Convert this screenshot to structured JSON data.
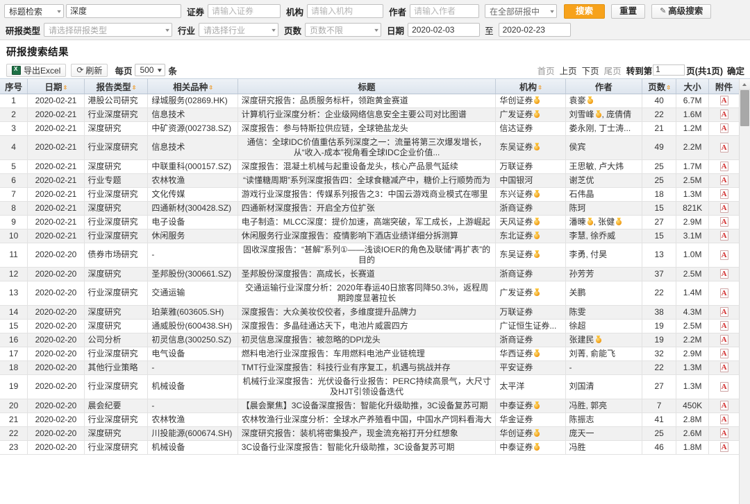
{
  "search": {
    "title_mode": "标题检索",
    "keyword_value": "深度",
    "security_label": "证券",
    "security_placeholder": "请输入证券",
    "org_label": "机构",
    "org_placeholder": "请输入机构",
    "author_label": "作者",
    "author_placeholder": "请输入作者",
    "scope_value": "在全部研报中",
    "search_button": "搜索",
    "reset_button": "重置",
    "advanced_button": "高级搜索",
    "report_type_label": "研报类型",
    "report_type_placeholder": "请选择研报类型",
    "industry_label": "行业",
    "industry_placeholder": "请选择行业",
    "pages_label": "页数",
    "pages_placeholder": "页数不限",
    "date_label": "日期",
    "date_from": "2020-02-03",
    "date_to": "2020-02-23",
    "date_sep": "至"
  },
  "result": {
    "heading": "研报搜索结果",
    "export_button": "导出Excel",
    "refresh_button": "刷新",
    "perpage_label": "每页",
    "perpage_value": "500",
    "perpage_unit": "条"
  },
  "pager": {
    "first": "首页",
    "prev": "上页",
    "next": "下页",
    "last": "尾页",
    "goto_label": "转到第",
    "page_value": "1",
    "total_label": "页(共1页)",
    "confirm": "确定"
  },
  "table": {
    "columns": [
      {
        "key": "idx",
        "label": "序号",
        "sort": false
      },
      {
        "key": "date",
        "label": "日期",
        "sort": true
      },
      {
        "key": "type",
        "label": "报告类型",
        "sort": true
      },
      {
        "key": "kind",
        "label": "相关品种",
        "sort": true
      },
      {
        "key": "title",
        "label": "标题",
        "sort": false
      },
      {
        "key": "org",
        "label": "机构",
        "sort": true
      },
      {
        "key": "auth",
        "label": "作者",
        "sort": false
      },
      {
        "key": "pages",
        "label": "页数",
        "sort": true
      },
      {
        "key": "size",
        "label": "大小",
        "sort": false
      },
      {
        "key": "att",
        "label": "附件",
        "sort": false
      }
    ],
    "rows": [
      {
        "idx": "1",
        "date": "2020-02-21",
        "type": "港股公司研究",
        "kind": "绿城服务(02869.HK)",
        "title": "深度研究报告：品质服务标杆，领跑黄金赛道",
        "title_center": false,
        "org": "华创证券",
        "org_medal": true,
        "auth": "袁豪",
        "auth_medal": true,
        "pages": "40",
        "size": "6.7M"
      },
      {
        "idx": "2",
        "date": "2020-02-21",
        "type": "行业深度研究",
        "kind": "信息技术",
        "title": "计算机行业深度分析：企业级网络信息安全主要公司对比图谱",
        "title_center": false,
        "org": "广发证券",
        "org_medal": true,
        "auth": "刘雪峰🏅, 庞倩倩",
        "auth_medal": false,
        "pages": "22",
        "size": "1.6M"
      },
      {
        "idx": "3",
        "date": "2020-02-21",
        "type": "深度研究",
        "kind": "中矿资源(002738.SZ)",
        "title": "深度报告：参与特斯拉供应链，全球铯盐龙头",
        "title_center": false,
        "org": "信达证券",
        "org_medal": false,
        "auth": "娄永刚, 丁士涛...",
        "auth_medal": false,
        "pages": "21",
        "size": "1.2M"
      },
      {
        "idx": "4",
        "date": "2020-02-21",
        "type": "行业深度研究",
        "kind": "信息技术",
        "title": "通信：全球IDC价值重估系列深度之一：流量将第三次爆发增长，从“收入-成本”视角看全球IDC企业价值...",
        "title_center": true,
        "org": "东吴证券",
        "org_medal": true,
        "auth": "侯宾",
        "auth_medal": false,
        "pages": "49",
        "size": "2.2M"
      },
      {
        "idx": "5",
        "date": "2020-02-21",
        "type": "深度研究",
        "kind": "中联重科(000157.SZ)",
        "title": "深度报告：混凝土机械与起重设备龙头，核心产品景气延续",
        "title_center": false,
        "org": "万联证券",
        "org_medal": false,
        "auth": "王思敏, 卢大炜",
        "auth_medal": false,
        "pages": "25",
        "size": "1.7M"
      },
      {
        "idx": "6",
        "date": "2020-02-21",
        "type": "行业专题",
        "kind": "农林牧渔",
        "title": "“读懂糖周期”系列深度报告四：全球食糖减产中，糖价上行顺势而为",
        "title_center": true,
        "org": "中国银河",
        "org_medal": false,
        "auth": "谢芝优",
        "auth_medal": false,
        "pages": "25",
        "size": "2.5M"
      },
      {
        "idx": "7",
        "date": "2020-02-21",
        "type": "行业深度研究",
        "kind": "文化传媒",
        "title": "游戏行业深度报告：传媒系列报告之3：中国云游戏商业模式在哪里",
        "title_center": false,
        "org": "东兴证券",
        "org_medal": true,
        "auth": "石伟晶",
        "auth_medal": false,
        "pages": "18",
        "size": "1.3M"
      },
      {
        "idx": "8",
        "date": "2020-02-21",
        "type": "深度研究",
        "kind": "四通新材(300428.SZ)",
        "title": "四通新材深度报告：开启全方位扩张",
        "title_center": false,
        "org": "浙商证券",
        "org_medal": false,
        "auth": "陈珂",
        "auth_medal": false,
        "pages": "15",
        "size": "821K"
      },
      {
        "idx": "9",
        "date": "2020-02-21",
        "type": "行业深度研究",
        "kind": "电子设备",
        "title": "电子制造：MLCC深度：提价加速，高端突破，军工成长，上游崛起",
        "title_center": false,
        "org": "天风证券",
        "org_medal": true,
        "auth": "潘暕🏅, 张健",
        "auth_medal": true,
        "pages": "27",
        "size": "2.9M"
      },
      {
        "idx": "10",
        "date": "2020-02-21",
        "type": "行业深度研究",
        "kind": "休闲服务",
        "title": "休闲服务行业深度报告：疫情影响下酒店业绩详细分拆测算",
        "title_center": false,
        "org": "东北证券",
        "org_medal": true,
        "auth": "李慧, 徐乔威",
        "auth_medal": false,
        "pages": "15",
        "size": "3.1M"
      },
      {
        "idx": "11",
        "date": "2020-02-20",
        "type": "债券市场研究",
        "kind": "-",
        "title": "固收深度报告：“甚解”系列①——浅谈IOER的角色及联储“再扩表”的目的",
        "title_center": true,
        "org": "东吴证券",
        "org_medal": true,
        "auth": "李勇, 付昊",
        "auth_medal": false,
        "pages": "13",
        "size": "1.0M"
      },
      {
        "idx": "12",
        "date": "2020-02-20",
        "type": "深度研究",
        "kind": "圣邦股份(300661.SZ)",
        "title": "圣邦股份深度报告：高成长，长赛道",
        "title_center": false,
        "org": "浙商证券",
        "org_medal": false,
        "auth": "孙芳芳",
        "auth_medal": false,
        "pages": "37",
        "size": "2.5M"
      },
      {
        "idx": "13",
        "date": "2020-02-20",
        "type": "行业深度研究",
        "kind": "交通运输",
        "title": "交通运输行业深度分析：2020年春运40日旅客同降50.3%，返程周期跨度显著拉长",
        "title_center": true,
        "org": "广发证券",
        "org_medal": true,
        "auth": "关鹏",
        "auth_medal": false,
        "pages": "22",
        "size": "1.4M"
      },
      {
        "idx": "14",
        "date": "2020-02-20",
        "type": "深度研究",
        "kind": "珀莱雅(603605.SH)",
        "title": "深度报告：大众美妆佼佼者，多维度提升品牌力",
        "title_center": false,
        "org": "万联证券",
        "org_medal": false,
        "auth": "陈雯",
        "auth_medal": false,
        "pages": "38",
        "size": "4.3M"
      },
      {
        "idx": "15",
        "date": "2020-02-20",
        "type": "深度研究",
        "kind": "通威股份(600438.SH)",
        "title": "深度报告：多晶硅通达天下，电池片威震四方",
        "title_center": false,
        "org": "广证恒生证券...",
        "org_medal": false,
        "auth": "徐超",
        "auth_medal": false,
        "pages": "19",
        "size": "2.5M"
      },
      {
        "idx": "16",
        "date": "2020-02-20",
        "type": "公司分析",
        "kind": "初灵信息(300250.SZ)",
        "title": "初灵信息深度报告：被忽略的DPI龙头",
        "title_center": false,
        "org": "浙商证券",
        "org_medal": false,
        "auth": "张建民",
        "auth_medal": true,
        "pages": "19",
        "size": "2.2M"
      },
      {
        "idx": "17",
        "date": "2020-02-20",
        "type": "行业深度研究",
        "kind": "电气设备",
        "title": "燃料电池行业深度报告：车用燃料电池产业链梳理",
        "title_center": false,
        "org": "华西证券",
        "org_medal": true,
        "auth": "刘菁, 俞能飞",
        "auth_medal": false,
        "pages": "32",
        "size": "2.9M"
      },
      {
        "idx": "18",
        "date": "2020-02-20",
        "type": "其他行业策略",
        "kind": "-",
        "title": "TMT行业深度报告：科技行业有序复工，机遇与挑战并存",
        "title_center": false,
        "org": "平安证券",
        "org_medal": false,
        "auth": "-",
        "auth_medal": false,
        "pages": "22",
        "size": "1.3M"
      },
      {
        "idx": "19",
        "date": "2020-02-20",
        "type": "行业深度研究",
        "kind": "机械设备",
        "title": "机械行业深度报告：光伏设备行业报告：PERC持续高景气，大尺寸及HJT引领设备迭代",
        "title_center": true,
        "org": "太平洋",
        "org_medal": false,
        "auth": "刘国清",
        "auth_medal": false,
        "pages": "27",
        "size": "1.3M"
      },
      {
        "idx": "20",
        "date": "2020-02-20",
        "type": "晨会纪要",
        "kind": "-",
        "title": "【晨会聚焦】3C设备深度报告：智能化升级助推，3C设备复苏可期",
        "title_center": false,
        "org": "中泰证券",
        "org_medal": true,
        "auth": "冯胜, 郭亮",
        "auth_medal": false,
        "pages": "7",
        "size": "450K"
      },
      {
        "idx": "21",
        "date": "2020-02-20",
        "type": "行业深度研究",
        "kind": "农林牧渔",
        "title": "农林牧渔行业深度分析：全球水产养殖看中国，中国水产饲料看海大",
        "title_center": true,
        "org": "华金证券",
        "org_medal": false,
        "auth": "陈振志",
        "auth_medal": false,
        "pages": "41",
        "size": "2.8M"
      },
      {
        "idx": "22",
        "date": "2020-02-20",
        "type": "深度研究",
        "kind": "川投能源(600674.SH)",
        "title": "深度研究报告：装机将密集投产，现金流充裕打开分红想象",
        "title_center": false,
        "org": "华创证券",
        "org_medal": true,
        "auth": "庞天一",
        "auth_medal": false,
        "pages": "25",
        "size": "2.6M"
      },
      {
        "idx": "23",
        "date": "2020-02-20",
        "type": "行业深度研究",
        "kind": "机械设备",
        "title": "3C设备行业深度报告：智能化升级助推，3C设备复苏可期",
        "title_center": false,
        "org": "中泰证券",
        "org_medal": true,
        "auth": "冯胜",
        "auth_medal": false,
        "pages": "46",
        "size": "1.8M"
      }
    ]
  }
}
